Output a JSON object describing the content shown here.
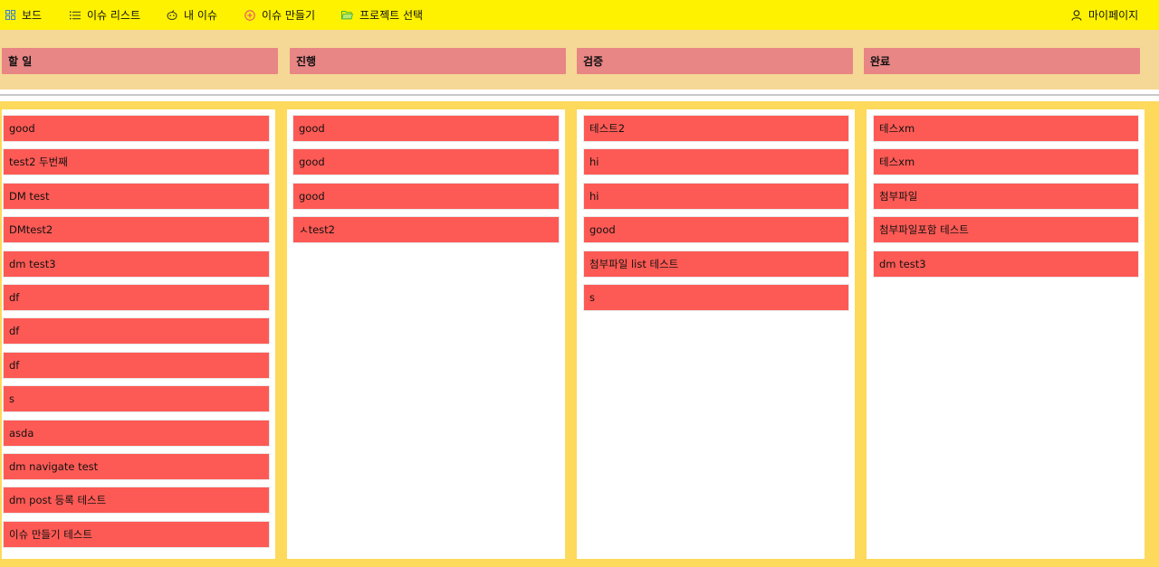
{
  "nav": {
    "board": "보드",
    "issue_list": "이슈 리스트",
    "my_issues": "내 이슈",
    "create_issue": "이슈 만들기",
    "select_project": "프로젝트 선택",
    "my_page": "마이페이지"
  },
  "colors": {
    "nav_bg": "#fff200",
    "header_band": "#f5d895",
    "column_header": "#e88585",
    "board_bg": "#fdd95c",
    "card": "#fe5a55",
    "create_icon": "#e0457b",
    "folder_icon": "#3cb043"
  },
  "columns": [
    {
      "title": "할 일",
      "cards": [
        "good",
        "test2 두번째",
        "DM test",
        "DMtest2",
        "dm test3",
        "df",
        "df",
        "df",
        "s",
        "asda",
        "dm navigate test",
        "dm post 등록 테스트",
        "이슈 만들기 테스트"
      ]
    },
    {
      "title": "진행",
      "cards": [
        "good",
        "good",
        "good",
        "ㅅtest2"
      ]
    },
    {
      "title": "검증",
      "cards": [
        "테스트2",
        "hi",
        "hi",
        "good",
        "첨부파일 list 테스트",
        "s"
      ]
    },
    {
      "title": "완료",
      "cards": [
        "테스xm",
        "테스xm",
        "첨부파일",
        "첨부파일포함 테스트",
        "dm test3"
      ]
    }
  ]
}
